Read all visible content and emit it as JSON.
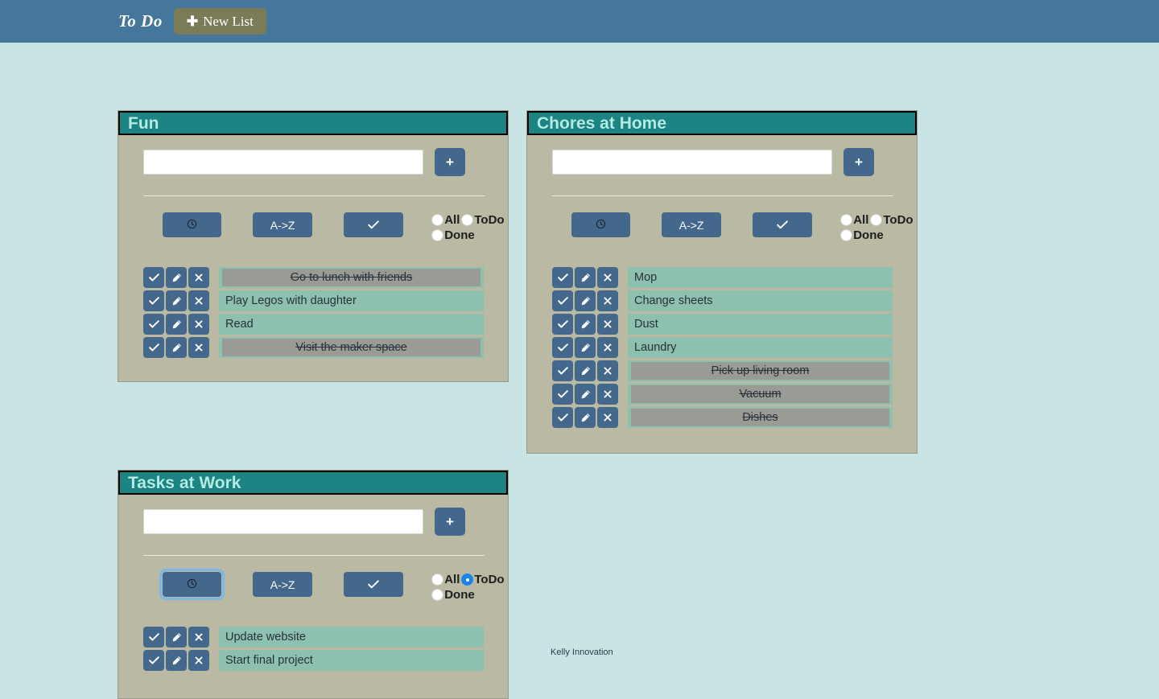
{
  "navbar": {
    "brand": "To Do",
    "new_list_label": "New List",
    "new_list_icon": "plus-icon",
    "background_color": "#44779b",
    "new_list_color": "#7b7b57"
  },
  "theme": {
    "page_background": "#c8e4e4",
    "card_header": "#1d8484",
    "card_body": "#b9b9a4",
    "button_blue": "#44688b",
    "task_row": "#8ec0b0",
    "done_band": "#9b9b96",
    "radio_selected": "#1c84e8"
  },
  "controls": {
    "input_placeholder": "",
    "input_value": "",
    "add_label": "+",
    "sort_date_label": "⊙",
    "sort_alpha_label": "A->Z",
    "sort_done_label": "✔",
    "filter_all": "All",
    "filter_todo": "ToDo",
    "filter_done": "Done",
    "action_check": "✔",
    "action_edit": "✎",
    "action_delete": "✖"
  },
  "lists": [
    {
      "title": "Fun",
      "selected_filter": "",
      "date_button_focused": false,
      "tasks": [
        {
          "text": "Go to lunch with friends",
          "done": true
        },
        {
          "text": "Play Legos with daughter",
          "done": false
        },
        {
          "text": "Read",
          "done": false
        },
        {
          "text": "Visit the maker space",
          "done": true
        }
      ]
    },
    {
      "title": "Chores at Home",
      "selected_filter": "",
      "date_button_focused": false,
      "tasks": [
        {
          "text": "Mop",
          "done": false
        },
        {
          "text": "Change sheets",
          "done": false
        },
        {
          "text": "Dust",
          "done": false
        },
        {
          "text": "Laundry",
          "done": false
        },
        {
          "text": "Pick up living room",
          "done": true
        },
        {
          "text": "Vacuum",
          "done": true
        },
        {
          "text": "Dishes",
          "done": true
        }
      ]
    },
    {
      "title": "Tasks at Work",
      "selected_filter": "ToDo",
      "date_button_focused": true,
      "tasks": [
        {
          "text": "Update website",
          "done": false
        },
        {
          "text": "Start final project",
          "done": false
        }
      ]
    }
  ],
  "footer": {
    "text": "Kelly Innovation"
  }
}
